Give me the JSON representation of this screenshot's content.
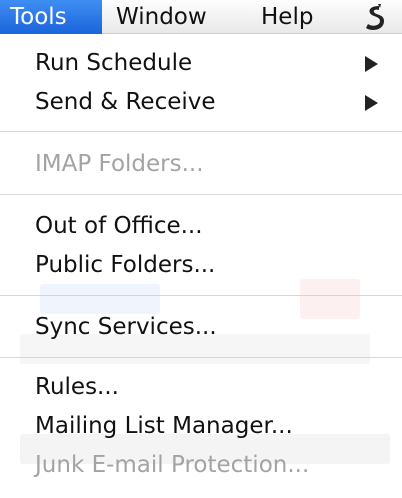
{
  "menubar": {
    "tools": "Tools",
    "window": "Window",
    "help": "Help",
    "script_icon": "applescript-icon"
  },
  "menu": {
    "run_schedule": "Run Schedule",
    "send_receive": "Send & Receive",
    "imap_folders": "IMAP Folders...",
    "out_of_office": "Out of Office...",
    "public_folders": "Public Folders...",
    "sync_services": "Sync Services...",
    "rules": "Rules...",
    "mailing_list_manager": "Mailing List Manager...",
    "junk_email_protection": "Junk E-mail Protection..."
  },
  "colors": {
    "active_menu": "#1b64dc",
    "disabled_text": "#a3a3a3"
  }
}
